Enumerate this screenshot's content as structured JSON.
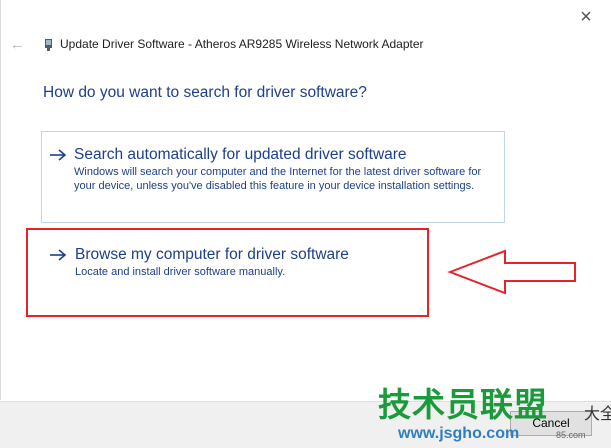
{
  "window": {
    "close_glyph": "×",
    "back_glyph": "←",
    "title": "Update Driver Software - Atheros AR9285 Wireless Network Adapter",
    "icon": "network-adapter-icon"
  },
  "main": {
    "heading": "How do you want to search for driver software?",
    "options": [
      {
        "title": "Search automatically for updated driver software",
        "description": "Windows will search your computer and the Internet for the latest driver software for your device, unless you've disabled this feature in your device installation settings.",
        "icon": "arrow-right-icon"
      },
      {
        "title": "Browse my computer for driver software",
        "description": "Locate and install driver software manually.",
        "icon": "arrow-right-icon"
      }
    ]
  },
  "footer": {
    "button_label": "Cancel"
  },
  "watermark": {
    "brand": "技术员联盟",
    "suffix": "大全",
    "url": "www.jsgho.com",
    "small": "85.com"
  },
  "colors": {
    "link_blue": "#1e3f8a",
    "highlight_red": "#e3242b",
    "hover_border": "#bfd7ee"
  }
}
